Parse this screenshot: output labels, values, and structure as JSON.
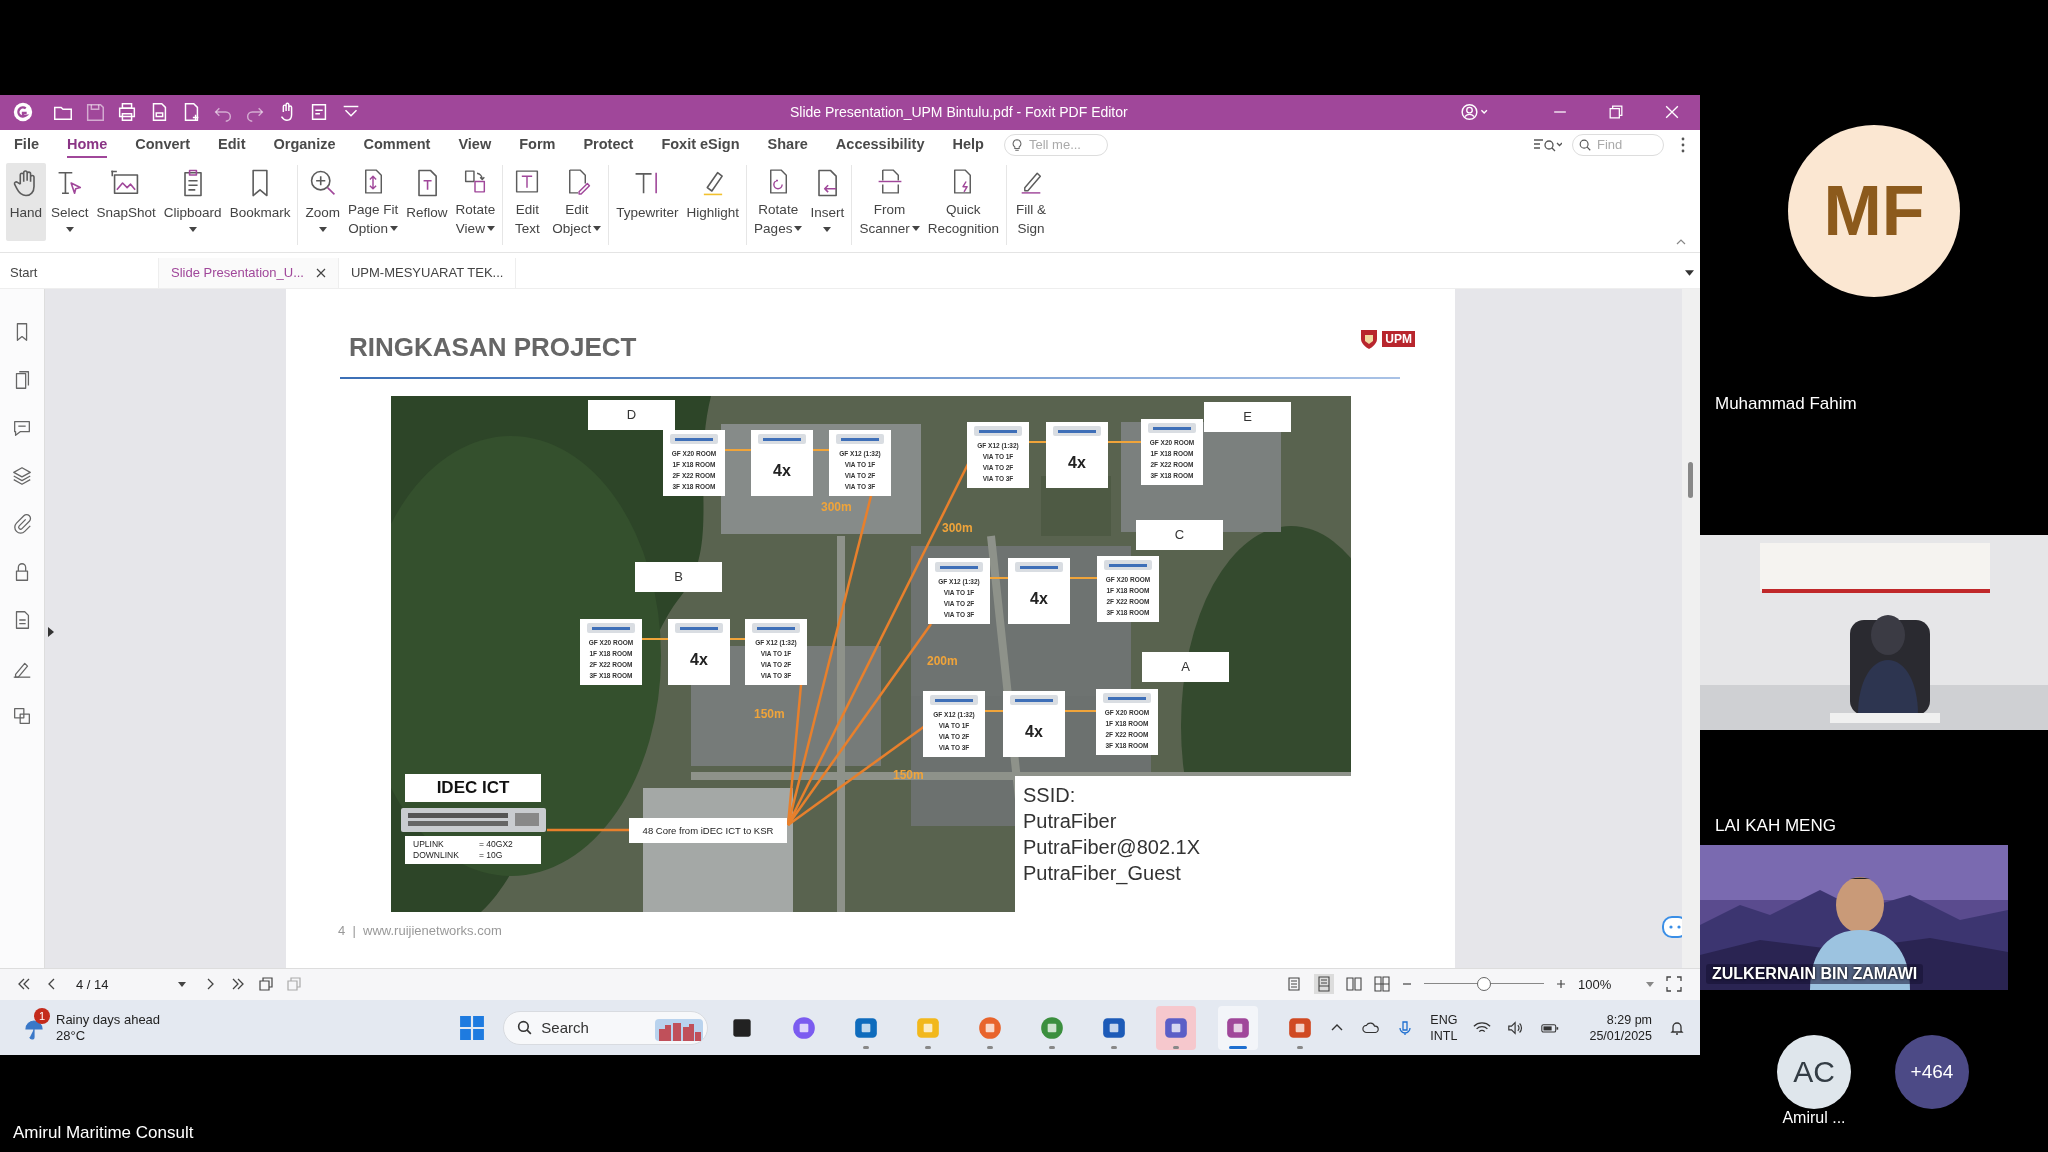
{
  "window": {
    "title": "Slide Presentation_UPM Bintulu.pdf - Foxit PDF Editor"
  },
  "menu": [
    {
      "label": "File",
      "selected": false
    },
    {
      "label": "Home",
      "selected": true
    },
    {
      "label": "Convert",
      "selected": false
    },
    {
      "label": "Edit",
      "selected": false
    },
    {
      "label": "Organize",
      "selected": false
    },
    {
      "label": "Comment",
      "selected": false
    },
    {
      "label": "View",
      "selected": false
    },
    {
      "label": "Form",
      "selected": false
    },
    {
      "label": "Protect",
      "selected": false
    },
    {
      "label": "Foxit eSign",
      "selected": false
    },
    {
      "label": "Share",
      "selected": false
    },
    {
      "label": "Accessibility",
      "selected": false
    },
    {
      "label": "Help",
      "selected": false
    }
  ],
  "tell_me": {
    "placeholder": "Tell me..."
  },
  "find": {
    "placeholder": "Find"
  },
  "ribbon": {
    "groups": [
      [
        {
          "lines": [
            "Hand"
          ],
          "dropdown": false,
          "selected": true
        },
        {
          "lines": [
            "Select"
          ],
          "dropdown": true,
          "selected": false
        },
        {
          "lines": [
            "SnapShot"
          ],
          "dropdown": false,
          "selected": false
        },
        {
          "lines": [
            "Clipboard"
          ],
          "dropdown": true,
          "selected": false
        },
        {
          "lines": [
            "Bookmark"
          ],
          "dropdown": false,
          "selected": false
        }
      ],
      [
        {
          "lines": [
            "Zoom"
          ],
          "dropdown": true,
          "selected": false
        },
        {
          "lines": [
            "Page Fit",
            "Option"
          ],
          "dropdown": true,
          "selected": false
        },
        {
          "lines": [
            "Reflow"
          ],
          "dropdown": false,
          "selected": false
        },
        {
          "lines": [
            "Rotate",
            "View"
          ],
          "dropdown": true,
          "selected": false
        }
      ],
      [
        {
          "lines": [
            "Edit",
            "Text"
          ],
          "dropdown": false,
          "selected": false
        },
        {
          "lines": [
            "Edit",
            "Object"
          ],
          "dropdown": true,
          "selected": false
        }
      ],
      [
        {
          "lines": [
            "Typewriter"
          ],
          "dropdown": false,
          "selected": false
        },
        {
          "lines": [
            "Highlight"
          ],
          "dropdown": false,
          "selected": false
        }
      ],
      [
        {
          "lines": [
            "Rotate",
            "Pages"
          ],
          "dropdown": true,
          "selected": false
        },
        {
          "lines": [
            "Insert"
          ],
          "dropdown": true,
          "selected": false
        }
      ],
      [
        {
          "lines": [
            "From",
            "Scanner"
          ],
          "dropdown": true,
          "selected": false
        },
        {
          "lines": [
            "Quick",
            "Recognition"
          ],
          "dropdown": false,
          "selected": false
        }
      ],
      [
        {
          "lines": [
            "Fill &",
            "Sign"
          ],
          "dropdown": false,
          "selected": false
        }
      ]
    ]
  },
  "doc_tabs": [
    {
      "label": "Start",
      "selected": false,
      "closable": false
    },
    {
      "label": "Slide Presentation_U...",
      "selected": true,
      "closable": true
    },
    {
      "label": "UPM-MESYUARAT TEK...",
      "selected": false,
      "closable": false
    }
  ],
  "slide": {
    "title": "RINGKASAN PROJECT",
    "logo": "UPM",
    "footer": "4  |  www.ruijienetworks.com",
    "diagram": {
      "callouts": [
        "D",
        "E",
        "C",
        "B",
        "A"
      ],
      "groups": [
        {
          "switch": "4x",
          "room": [
            "GF X20 ROOM",
            "1F X18 ROOM",
            "2F X22 ROOM",
            "3F X18 ROOM"
          ],
          "splitter": [
            "GF X12 (1:32)",
            "VIA TO 1F",
            "VIA TO 2F",
            "VIA TO 3F"
          ]
        },
        {
          "switch": "4x",
          "room": [
            "GF X20 ROOM",
            "1F X18 ROOM",
            "2F X22 ROOM",
            "3F X18 ROOM"
          ],
          "splitter": [
            "GF X12 (1:32)",
            "VIA TO 1F",
            "VIA TO 2F",
            "VIA TO 3F"
          ]
        },
        {
          "switch": "4x",
          "room": [
            "GF X20 ROOM",
            "1F X18 ROOM",
            "2F X22 ROOM",
            "3F X18 ROOM"
          ],
          "splitter": [
            "GF X12 (1:32)",
            "VIA TO 1F",
            "VIA TO 2F",
            "VIA TO 3F"
          ]
        },
        {
          "switch": "4x",
          "room": [
            "GF X20 ROOM",
            "1F X18 ROOM",
            "2F X22 ROOM",
            "3F X18 ROOM"
          ],
          "splitter": [
            "GF X12 (1:32)",
            "VIA TO 1F",
            "VIA TO 2F",
            "VIA TO 3F"
          ]
        },
        {
          "switch": "4x",
          "room": [
            "GF X20 ROOM",
            "1F X18 ROOM",
            "2F X22 ROOM",
            "3F X18 ROOM"
          ],
          "splitter": [
            "GF X12 (1:32)",
            "VIA TO 1F",
            "VIA TO 2F",
            "VIA TO 3F"
          ]
        }
      ],
      "distances": [
        "300m",
        "300m",
        "200m",
        "150m",
        "150m"
      ],
      "core": {
        "title": "IDEC ICT",
        "specs": [
          [
            "UPLINK",
            "= 40GX2"
          ],
          [
            "DOWNLINK",
            "= 10G"
          ]
        ]
      },
      "link": "48 Core from iDEC ICT to KSR",
      "ssid": [
        "SSID:",
        "PutraFiber",
        "PutraFiber@802.1X",
        "PutraFiber_Guest"
      ]
    }
  },
  "page_nav": {
    "page": "4 / 14"
  },
  "zoom": {
    "level": 0.5,
    "reading": "100%"
  },
  "taskbar": {
    "weather": {
      "badge": "1",
      "title": "Rainy days ahead",
      "temp": "28°C"
    },
    "search": {
      "placeholder": "Search"
    },
    "apps": [
      {
        "running": false,
        "active": false,
        "flashing": false
      },
      {
        "running": false,
        "active": false,
        "flashing": false
      },
      {
        "running": true,
        "active": false,
        "flashing": false
      },
      {
        "running": true,
        "active": false,
        "flashing": false
      },
      {
        "running": true,
        "active": false,
        "flashing": false
      },
      {
        "running": true,
        "active": false,
        "flashing": false
      },
      {
        "running": true,
        "active": false,
        "flashing": false
      },
      {
        "running": true,
        "active": false,
        "flashing": true
      },
      {
        "running": true,
        "active": true,
        "flashing": false
      },
      {
        "running": true,
        "active": false,
        "flashing": false
      }
    ],
    "language": [
      "ENG",
      "INTL"
    ],
    "time": "8:29 pm",
    "date": "25/01/2025"
  },
  "meeting": {
    "tiles": [
      {
        "kind": "avatar",
        "initials": "MF",
        "name": "Muhammad Fahim"
      },
      {
        "kind": "video",
        "name": "LAI KAH MENG"
      },
      {
        "kind": "video_overlay",
        "name": "ZULKERNAIN BIN ZAMAWI"
      }
    ],
    "others": [
      {
        "initials": "AC",
        "name": "Amirul ..."
      }
    ],
    "overflow": "+464",
    "presenter": "Amirul Maritime Consult"
  }
}
